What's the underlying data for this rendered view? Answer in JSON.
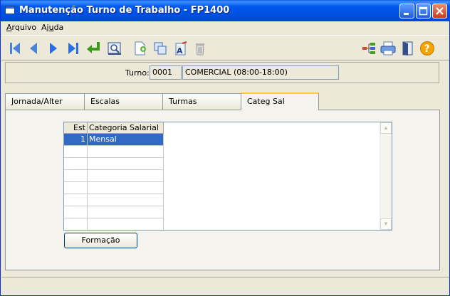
{
  "window": {
    "title": "Manutenção Turno de Trabalho - FP1400"
  },
  "menu": [
    {
      "label_prefix": "",
      "label_hot": "A",
      "label_rest": "rquivo"
    },
    {
      "label_prefix": "Aj",
      "label_hot": "u",
      "label_rest": "da"
    }
  ],
  "toolbar_icons": [
    "first-record-icon",
    "previous-record-icon",
    "next-record-icon",
    "last-record-icon",
    "confirm-icon",
    "search-icon",
    "new-document-icon",
    "copy-icon",
    "edit-text-icon",
    "delete-trash-icon",
    "tree-structure-icon",
    "print-icon",
    "exit-door-icon",
    "help-icon"
  ],
  "turno": {
    "label": "Turno:",
    "code": "0001",
    "description": "COMERCIAL (08:00-18:00)"
  },
  "tabs": [
    "Jornada/Alter",
    "Escalas",
    "Turmas",
    "Categ Sal"
  ],
  "active_tab": "Categ Sal",
  "grid": {
    "headers": [
      "Est",
      "Categoria Salarial"
    ],
    "rows": [
      {
        "est": "1",
        "categoria": "Mensal"
      }
    ]
  },
  "formacao_button": "Formação",
  "colors": {
    "selection": "#316ac5",
    "titlebar": "#0058ee",
    "tab_highlight": "#ffc83c"
  }
}
